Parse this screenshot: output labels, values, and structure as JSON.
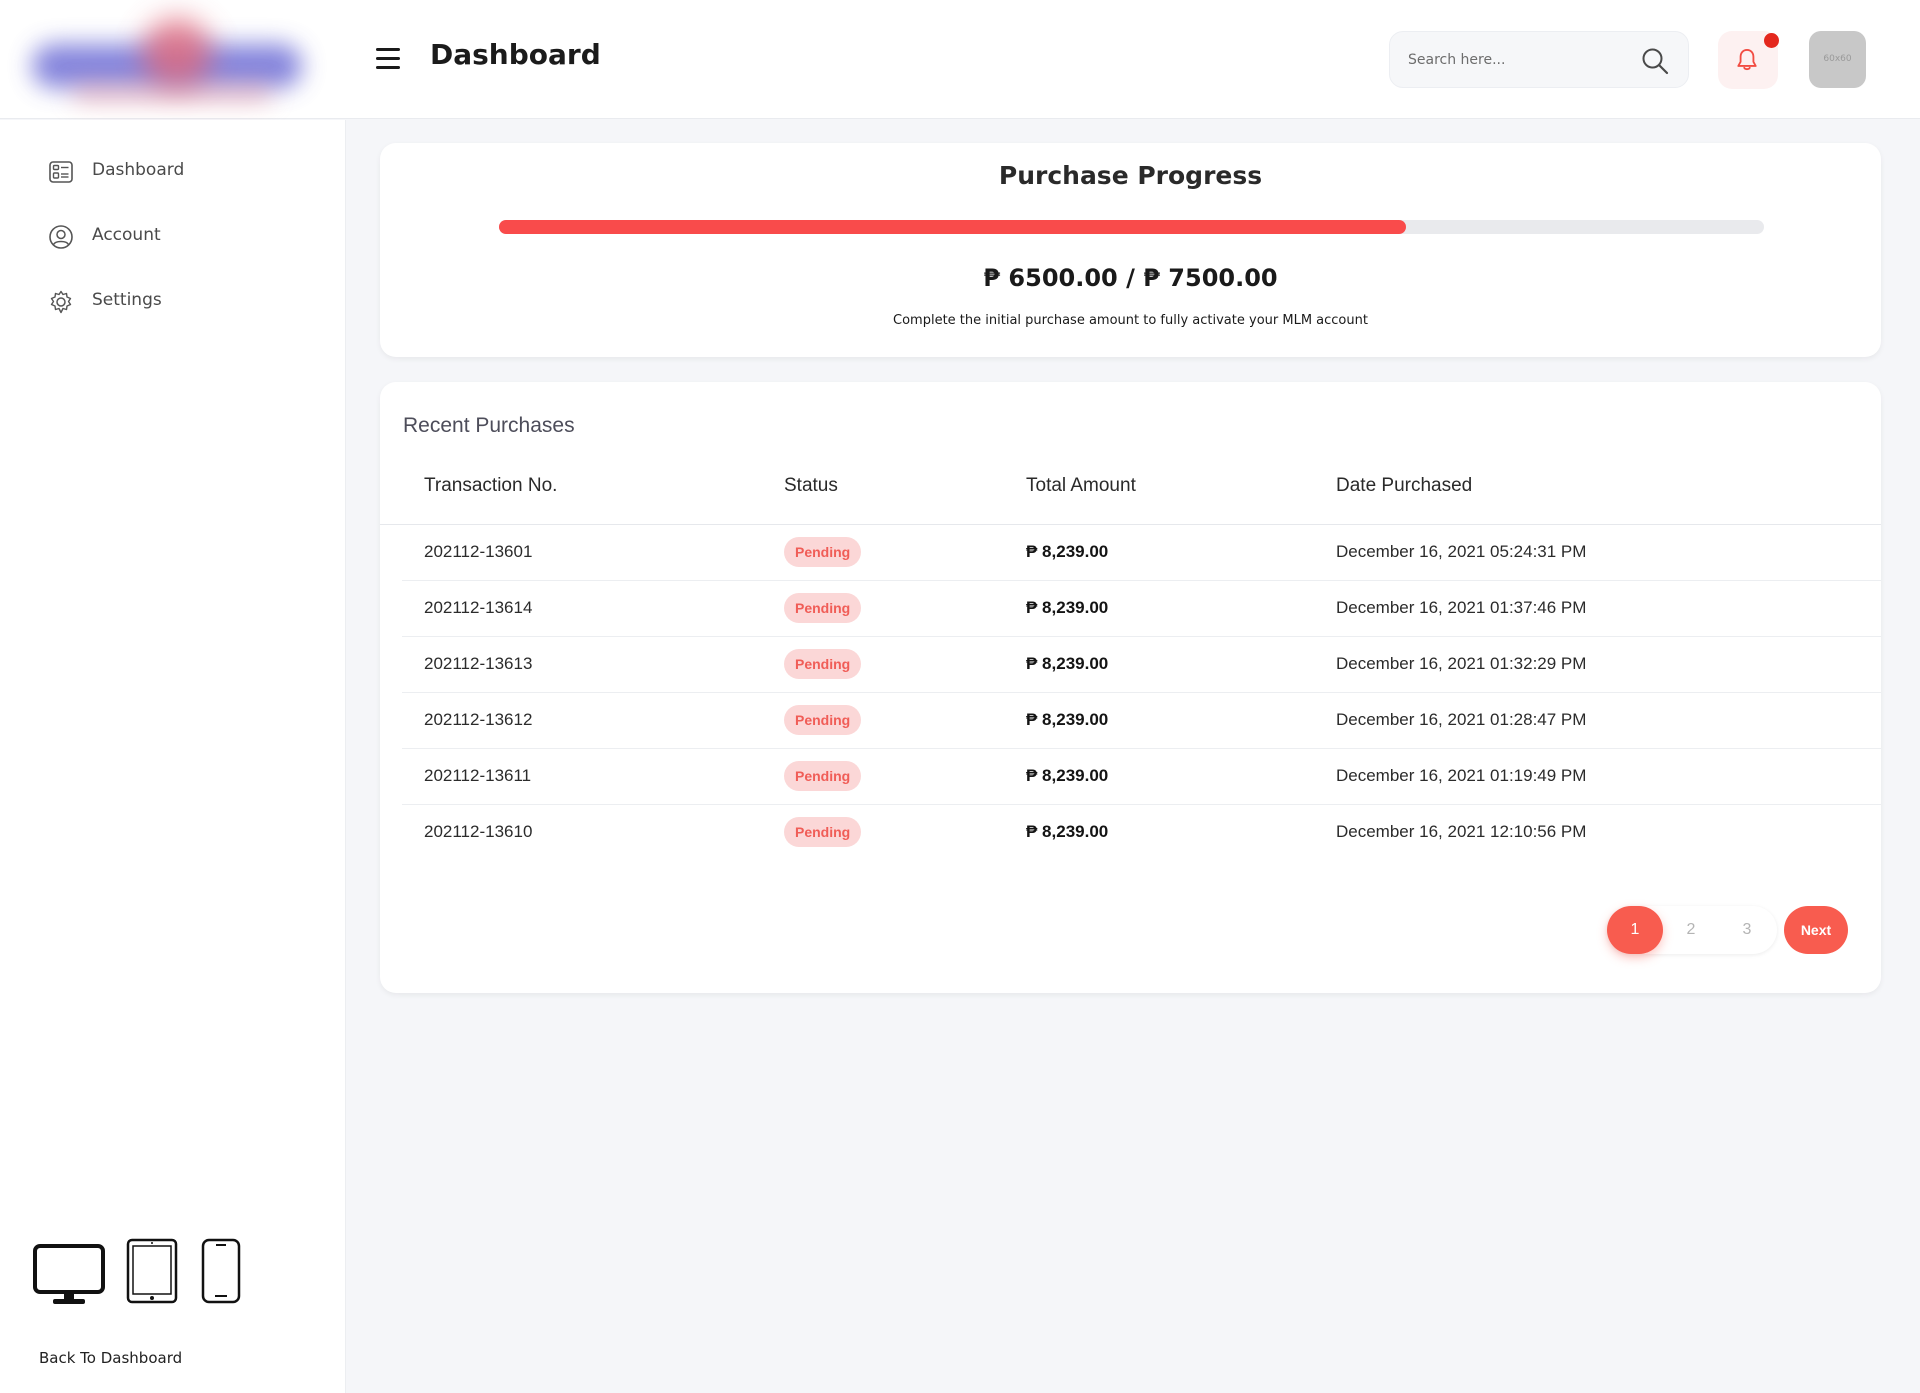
{
  "header": {
    "title": "Dashboard",
    "search_placeholder": "Search here...",
    "avatar_label": "60x60"
  },
  "sidebar": {
    "items": [
      {
        "label": "Dashboard",
        "icon": "dashboard-icon"
      },
      {
        "label": "Account",
        "icon": "account-icon"
      },
      {
        "label": "Settings",
        "icon": "gear-icon"
      }
    ],
    "device_icons": [
      "desktop-icon",
      "tablet-icon",
      "phone-icon"
    ],
    "back_label": "Back To Dashboard"
  },
  "progress": {
    "title": "Purchase Progress",
    "current": "₱ 6500.00",
    "separator": "/",
    "target": "₱ 7500.00",
    "fraction": 0.7167,
    "note": "Complete the initial purchase amount to fully activate your MLM account"
  },
  "purchases": {
    "title": "Recent Purchases",
    "columns": [
      "Transaction No.",
      "Status",
      "Total Amount",
      "Date Purchased"
    ],
    "rows": [
      {
        "txn": "202112-13601",
        "status": "Pending",
        "amount": "₱ 8,239.00",
        "date": "December 16, 2021 05:24:31 PM"
      },
      {
        "txn": "202112-13614",
        "status": "Pending",
        "amount": "₱ 8,239.00",
        "date": "December 16, 2021 01:37:46 PM"
      },
      {
        "txn": "202112-13613",
        "status": "Pending",
        "amount": "₱ 8,239.00",
        "date": "December 16, 2021 01:32:29 PM"
      },
      {
        "txn": "202112-13612",
        "status": "Pending",
        "amount": "₱ 8,239.00",
        "date": "December 16, 2021 01:28:47 PM"
      },
      {
        "txn": "202112-13611",
        "status": "Pending",
        "amount": "₱ 8,239.00",
        "date": "December 16, 2021 01:19:49 PM"
      },
      {
        "txn": "202112-13610",
        "status": "Pending",
        "amount": "₱ 8,239.00",
        "date": "December 16, 2021 12:10:56 PM"
      }
    ]
  },
  "pagination": {
    "pages": [
      "1",
      "2",
      "3"
    ],
    "active": "1",
    "next_label": "Next"
  },
  "colors": {
    "accent": "#f85c4f",
    "progress_fill": "#f94b4b",
    "badge_bg": "#fbd7d7",
    "badge_text": "#f05d57",
    "notification_dot": "#e4281e"
  }
}
